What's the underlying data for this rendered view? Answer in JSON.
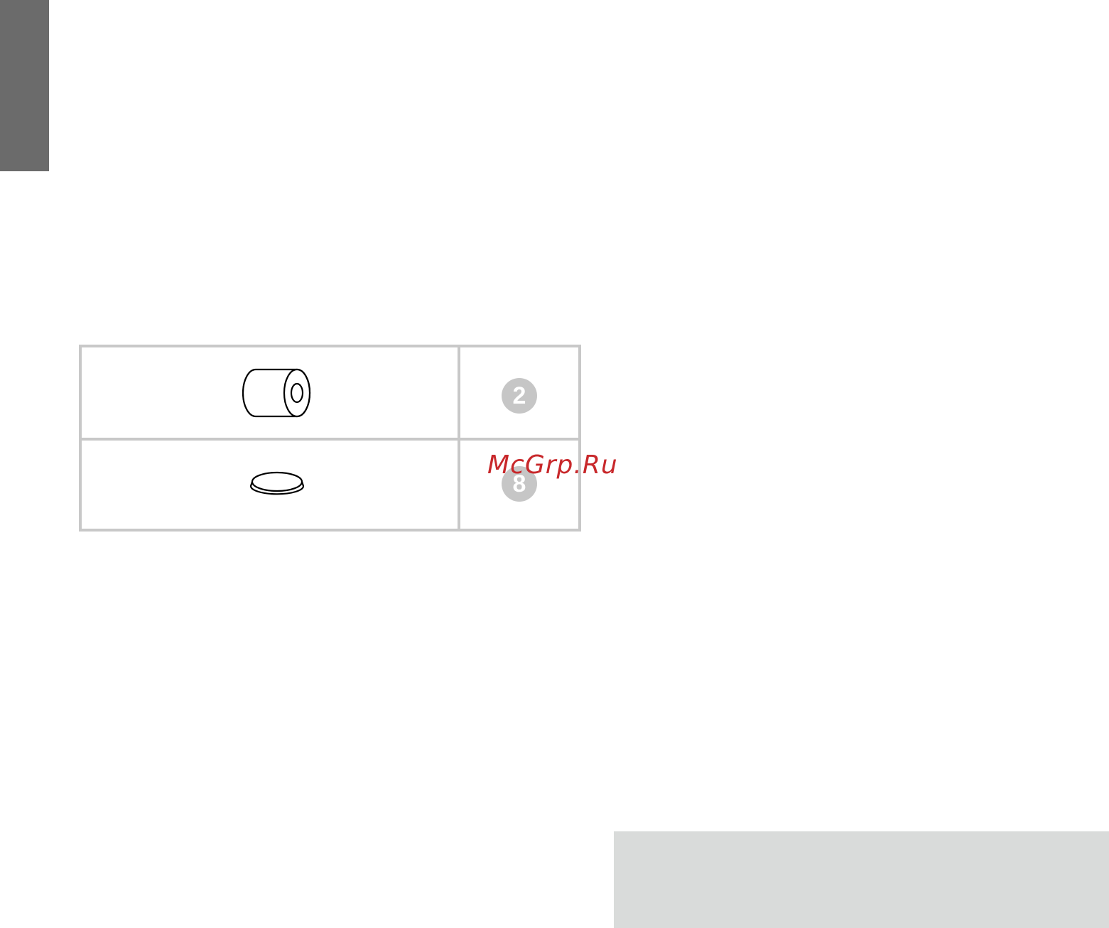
{
  "page": {
    "colors": {
      "side_tab": "#6b6b6b",
      "footer_block": "#d9dbda",
      "table_border": "#c8c8c8",
      "badge_fill": "#c6c6c6",
      "badge_text": "#ffffff",
      "watermark": "#c8282b"
    }
  },
  "parts_table": {
    "rows": [
      {
        "icon": "cylindrical-spacer-icon",
        "quantity": "2"
      },
      {
        "icon": "round-bumper-pad-icon",
        "quantity": "8"
      }
    ]
  },
  "watermark": {
    "text": "McGrp.Ru"
  }
}
